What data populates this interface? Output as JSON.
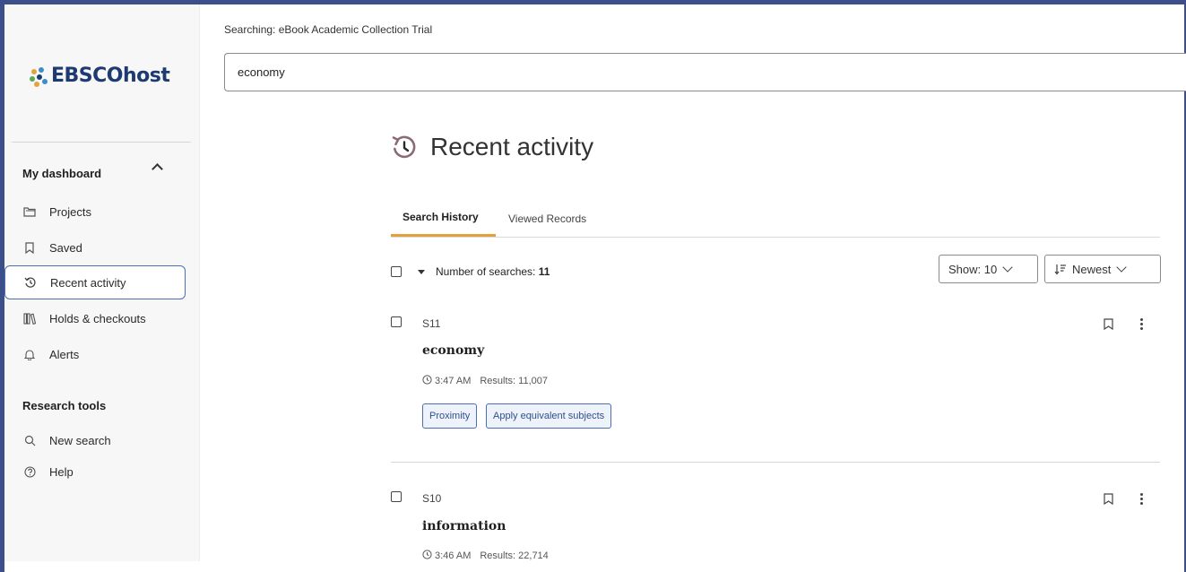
{
  "brand": {
    "logo_text": "EBSCOhost"
  },
  "search": {
    "searching_label": "Searching:  eBook Academic Collection Trial",
    "query": "economy"
  },
  "sidebar": {
    "dashboard_heading": "My dashboard",
    "items": [
      {
        "label": "Projects",
        "icon": "folder-icon"
      },
      {
        "label": "Saved",
        "icon": "bookmark-icon"
      },
      {
        "label": "Recent activity",
        "icon": "history-icon",
        "active": true
      },
      {
        "label": "Holds & checkouts",
        "icon": "books-icon"
      },
      {
        "label": "Alerts",
        "icon": "bell-icon"
      }
    ],
    "tools_heading": "Research tools",
    "tools": [
      {
        "label": "New search",
        "icon": "search-icon"
      },
      {
        "label": "Help",
        "icon": "help-icon"
      }
    ]
  },
  "main": {
    "title": "Recent activity",
    "tabs": [
      {
        "label": "Search History",
        "active": true
      },
      {
        "label": "Viewed Records",
        "active": false
      }
    ],
    "count_label": "Number of searches: ",
    "count_value": "11",
    "show_select": "Show: 10",
    "sort_select": "Newest",
    "entries": [
      {
        "id": "S11",
        "term": "economy",
        "time": "3:47 AM",
        "results": "Results: 11,007",
        "tags": [
          "Proximity",
          "Apply equivalent subjects"
        ]
      },
      {
        "id": "S10",
        "term": "information",
        "time": "3:46 AM",
        "results": "Results: 22,714",
        "tags": []
      }
    ]
  },
  "colors": {
    "frame": "#3c4f8a",
    "brand_navy": "#1e3a72",
    "tab_underline": "#e2a13c",
    "chip_border": "#4a6fb4",
    "history_icon": "#8a6b78"
  }
}
